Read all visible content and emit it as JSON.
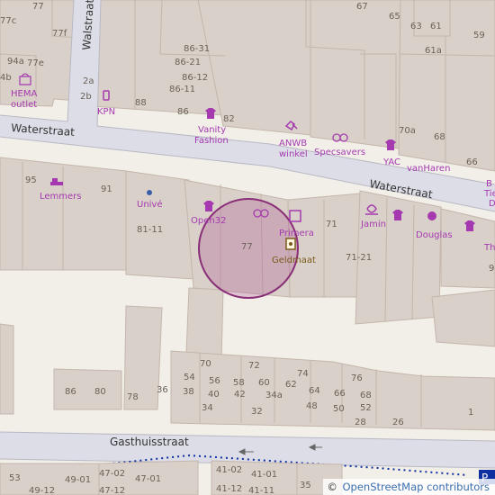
{
  "map": {
    "streets": {
      "waterstraat": "Waterstraat",
      "walstraat": "Walstraat",
      "gasthuisstraat": "Gasthuisstraat"
    },
    "pois": {
      "hema": "HEMA outlet",
      "kpn": "KPN",
      "vanity_fashion": "Vanity Fashion",
      "anwb_winkel": "ANWB winkel",
      "specsavers": "Specsavers",
      "yac": "YAC",
      "vanharen": "vanHaren",
      "lemmers": "Lemmers",
      "unive": "Univé",
      "open32": "Open32",
      "primera": "Primera",
      "geldmaat": "Geldmaat",
      "jamin": "Jamin",
      "douglas": "Douglas",
      "cut_right_1": "B",
      "cut_right_2": "Tie",
      "cut_right_3": "D",
      "cut_right_4": "Th"
    },
    "house_numbers": {
      "top_left": [
        "77",
        "77c",
        "77f",
        "77e",
        "94a",
        "4b",
        "2a",
        "2b"
      ],
      "top_mid": [
        "86-31",
        "86-21",
        "86-12",
        "86-11",
        "86",
        "88",
        "82"
      ],
      "top_right": [
        "67",
        "65",
        "63",
        "61",
        "61a",
        "59",
        "70a",
        "68",
        "66"
      ],
      "mid": [
        "95",
        "91",
        "81-11",
        "77",
        "71",
        "71-21",
        "9"
      ],
      "lower": [
        "70",
        "72",
        "74",
        "76",
        "54",
        "56",
        "58",
        "60",
        "62",
        "64",
        "66",
        "68",
        "38",
        "40",
        "42",
        "34a",
        "34",
        "32",
        "48",
        "50",
        "52",
        "28",
        "26",
        "1",
        "86",
        "80",
        "78",
        "36"
      ],
      "bottom": [
        "53",
        "49-12",
        "49-01",
        "47-02",
        "47-12",
        "47-01",
        "41-02",
        "41-12",
        "41-01",
        "41-11",
        "35"
      ]
    },
    "footer_cut": "P",
    "attribution": {
      "copy": "©",
      "link": "OpenStreetMap contributors"
    },
    "colors": {
      "background": "#f2efe9",
      "building": "#d9d0c9",
      "building_outline": "#c4b6ab",
      "pedestrian": "#dddde8",
      "road_outline": "#b8b8c4",
      "shop": "#a53ab0",
      "highlight_fill": "#a83c8c",
      "route": "#0d2fa0"
    }
  }
}
